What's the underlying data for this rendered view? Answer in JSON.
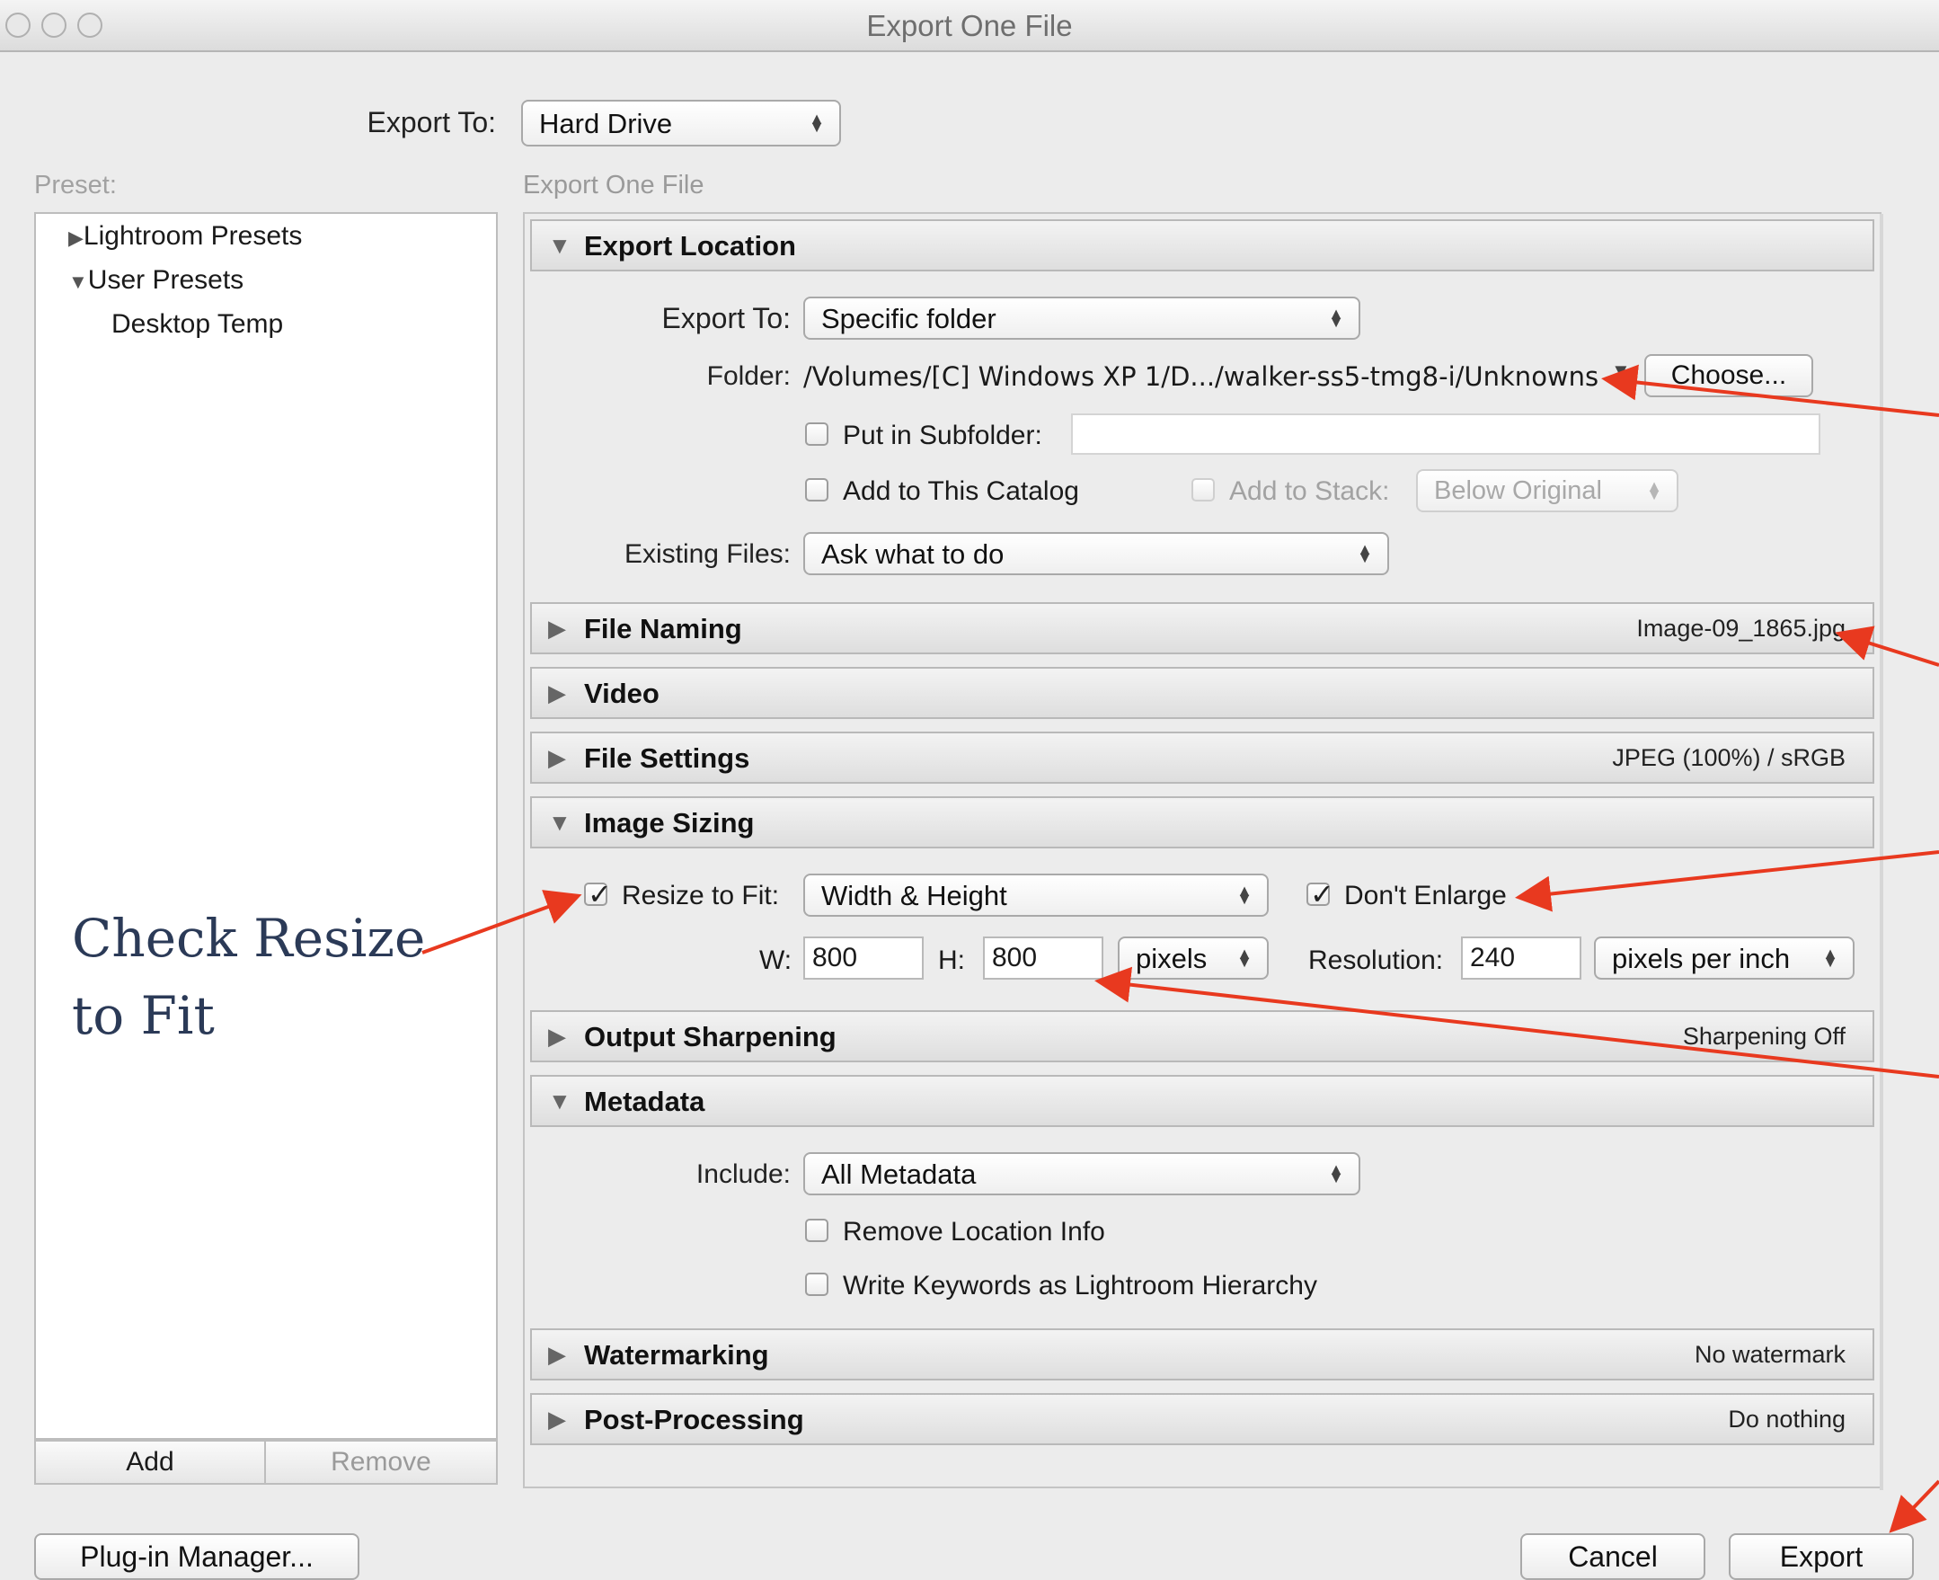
{
  "window": {
    "title": "Export One File"
  },
  "top": {
    "export_to_label": "Export To:",
    "export_to_value": "Hard Drive"
  },
  "preset": {
    "label": "Preset:",
    "items": [
      {
        "label": "Lightroom Presets",
        "icon": "triangle-right-icon"
      },
      {
        "label": "User Presets",
        "icon": "triangle-down-icon"
      },
      {
        "label": "Desktop Temp"
      }
    ],
    "add_label": "Add",
    "remove_label": "Remove"
  },
  "panel_title": "Export One File",
  "export_location": {
    "title": "Export Location",
    "export_to_label": "Export To:",
    "export_to_value": "Specific folder",
    "folder_label": "Folder:",
    "folder_path": "/Volumes/[C] Windows XP 1/D.../walker-ss5-tmg8-i/Unknowns",
    "choose_label": "Choose...",
    "subfolder_label": "Put in Subfolder:",
    "subfolder_value": "",
    "add_catalog_label": "Add to This Catalog",
    "add_stack_label": "Add to Stack:",
    "add_stack_value": "Below Original",
    "existing_label": "Existing Files:",
    "existing_value": "Ask what to do"
  },
  "file_naming": {
    "title": "File Naming",
    "summary": "Image-09_1865.jpg"
  },
  "video": {
    "title": "Video"
  },
  "file_settings": {
    "title": "File Settings",
    "summary": "JPEG (100%) / sRGB"
  },
  "image_sizing": {
    "title": "Image Sizing",
    "resize_label": "Resize to Fit:",
    "resize_checked": true,
    "resize_value": "Width & Height",
    "dont_enlarge_label": "Don't Enlarge",
    "dont_enlarge_checked": true,
    "w_label": "W:",
    "w_value": "800",
    "h_label": "H:",
    "h_value": "800",
    "units_value": "pixels",
    "resolution_label": "Resolution:",
    "resolution_value": "240",
    "resolution_units": "pixels per inch"
  },
  "output_sharpening": {
    "title": "Output Sharpening",
    "summary": "Sharpening Off"
  },
  "metadata": {
    "title": "Metadata",
    "include_label": "Include:",
    "include_value": "All Metadata",
    "remove_location_label": "Remove Location Info",
    "write_keywords_label": "Write Keywords as Lightroom Hierarchy"
  },
  "watermarking": {
    "title": "Watermarking",
    "summary": "No watermark"
  },
  "post_processing": {
    "title": "Post-Processing",
    "summary": "Do nothing"
  },
  "footer": {
    "plugin_label": "Plug-in Manager...",
    "cancel_label": "Cancel",
    "export_label": "Export"
  },
  "annotation": {
    "line1": "Check Resize",
    "line2": "to Fit",
    "arrow_color": "#e8391f"
  }
}
